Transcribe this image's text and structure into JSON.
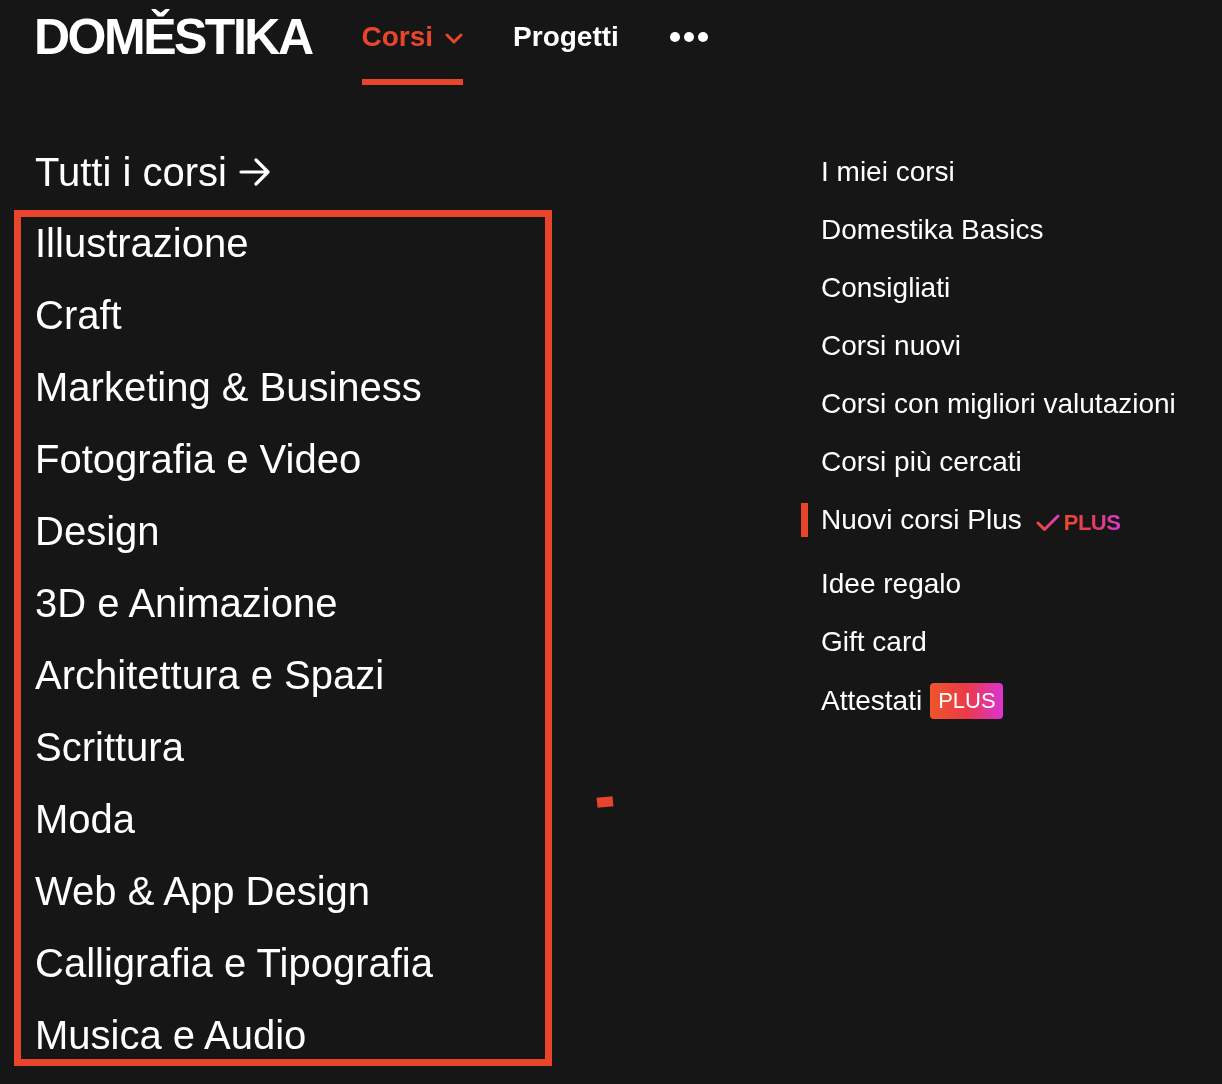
{
  "header": {
    "logo": "DOMĚSTIKA",
    "nav": [
      {
        "kind": "dropdown",
        "label": "Corsi",
        "selected": true
      },
      {
        "kind": "link",
        "label": "Progetti",
        "selected": false
      },
      {
        "kind": "more",
        "selected": false
      }
    ]
  },
  "categories": {
    "all_link": "Tutti i corsi",
    "highlighted": true,
    "items": [
      "Illustrazione",
      "Craft",
      "Marketing & Business",
      "Fotografia e Video",
      "Design",
      "3D e Animazione",
      "Architettura e Spazi",
      "Scrittura",
      "Moda",
      "Web & App Design",
      "Calligrafia e Tipografia",
      "Musica e Audio"
    ]
  },
  "links": [
    {
      "label": "I miei corsi",
      "selected": false
    },
    {
      "label": "Domestika Basics",
      "selected": false
    },
    {
      "label": "Consigliati",
      "selected": false
    },
    {
      "label": "Corsi nuovi",
      "selected": false
    },
    {
      "label": "Corsi con migliori valutazioni",
      "selected": false
    },
    {
      "label": "Corsi più cercati",
      "selected": false
    },
    {
      "label": "Nuovi corsi Plus",
      "selected": true,
      "badge": {
        "kind": "plus-mark",
        "text": "PLUS"
      }
    },
    {
      "label": "Idee regalo",
      "selected": false
    },
    {
      "label": "Gift card",
      "selected": false
    },
    {
      "label": "Attestati",
      "selected": false,
      "badge": {
        "kind": "plus-badge",
        "text": "PLUS"
      }
    }
  ]
}
